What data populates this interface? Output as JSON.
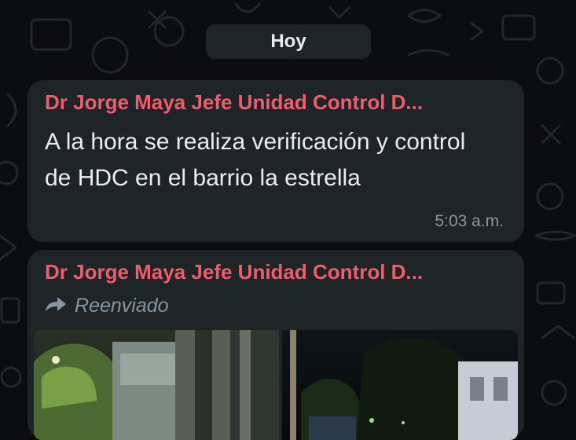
{
  "date_separator": "Hoy",
  "messages": [
    {
      "sender": "Dr Jorge Maya Jefe Unidad Control D...",
      "text": "A la hora se realiza verificación y control de HDC en el barrio la estrella",
      "time": "5:03 a.m."
    },
    {
      "sender": "Dr Jorge Maya Jefe Unidad Control D...",
      "forwarded_label": "Reenviado",
      "forward_icon": "forward-arrow-icon",
      "attachment": "photo"
    }
  ],
  "colors": {
    "background": "#0b0d0e",
    "bubble": "#1f2426",
    "sender": "#f15c6d",
    "text": "#e9edef",
    "meta": "#8696a0"
  }
}
